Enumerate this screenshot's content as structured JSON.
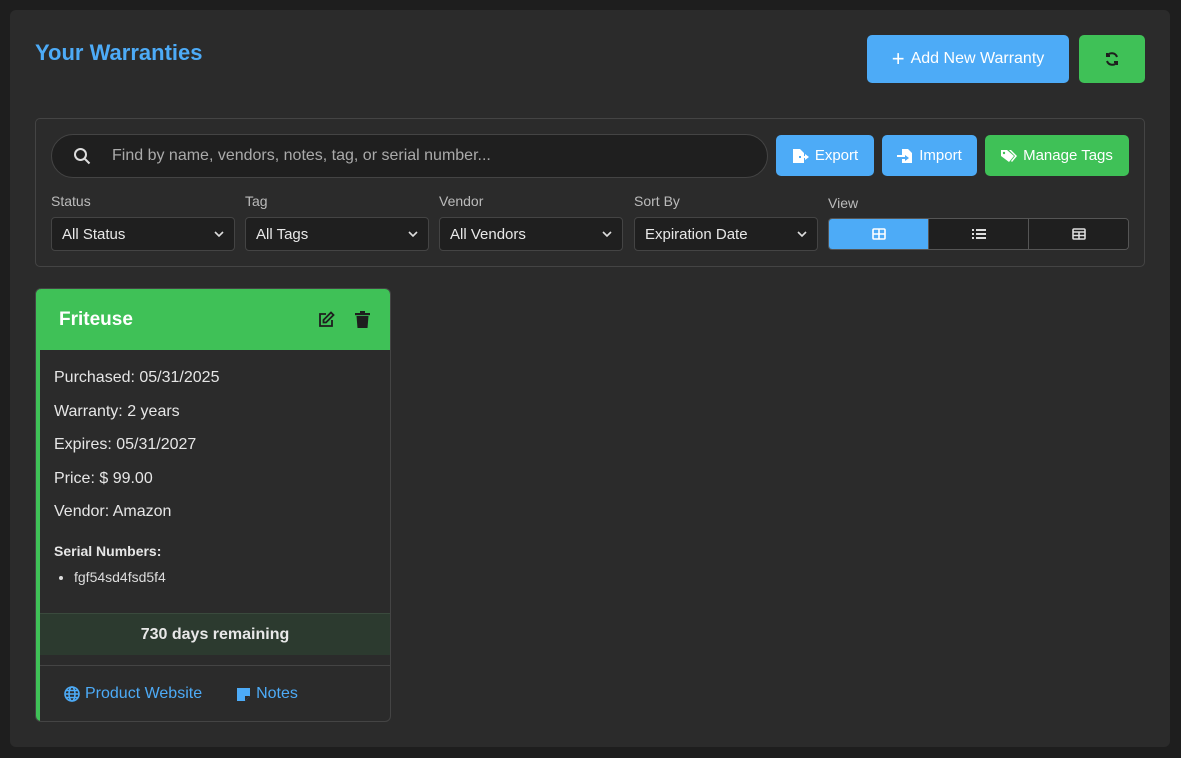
{
  "header": {
    "title": "Your Warranties",
    "add_label": "Add New Warranty"
  },
  "toolbar": {
    "search_placeholder": "Find by name, vendors, notes, tag, or serial number...",
    "export_label": "Export",
    "import_label": "Import",
    "manage_tags_label": "Manage Tags"
  },
  "filters": {
    "status": {
      "label": "Status",
      "value": "All Status"
    },
    "tag": {
      "label": "Tag",
      "value": "All Tags"
    },
    "vendor": {
      "label": "Vendor",
      "value": "All Vendors"
    },
    "sort": {
      "label": "Sort By",
      "value": "Expiration Date"
    },
    "view": {
      "label": "View",
      "active": "grid"
    }
  },
  "cards": [
    {
      "title": "Friteuse",
      "purchased": "Purchased: 05/31/2025",
      "warranty": "Warranty: 2 years",
      "expires": "Expires: 05/31/2027",
      "price": "Price: $ 99.00",
      "vendor": "Vendor: Amazon",
      "serial_heading": "Serial Numbers:",
      "serials": [
        "fgf54sd4fsd5f4"
      ],
      "remaining": "730 days remaining",
      "link_website": "Product Website",
      "link_notes": "Notes"
    }
  ],
  "colors": {
    "accent_blue": "#4dabf7",
    "accent_green": "#3fc157",
    "background": "#2b2b2b"
  }
}
